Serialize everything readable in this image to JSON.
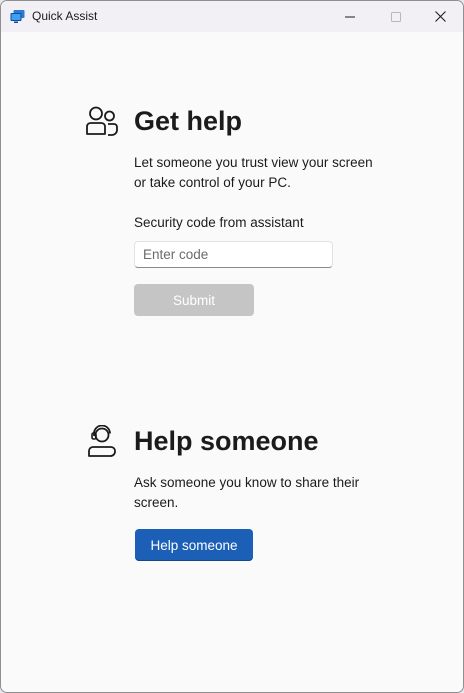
{
  "window": {
    "title": "Quick Assist",
    "icon": "quick-assist-app-icon",
    "controls": [
      "minimize-icon",
      "maximize-icon",
      "close-icon"
    ]
  },
  "get_help": {
    "icon": "people-icon",
    "heading": "Get help",
    "description_line1": "Let someone you trust view your screen",
    "description_line2": "or take control of your PC.",
    "code_label": "Security code from assistant",
    "code_value": "",
    "code_placeholder": "Enter code",
    "submit_label": "Submit",
    "submit_enabled": false
  },
  "help_someone": {
    "icon": "person-headset-icon",
    "heading": "Help someone",
    "description_line1": "Ask someone you know to share their",
    "description_line2": "screen.",
    "button_label": "Help someone"
  },
  "colors": {
    "accent": "#1b5fb6",
    "disabled_button": "#c5c5c5",
    "background": "#fbfafb",
    "titlebar": "#f2f0f4"
  }
}
